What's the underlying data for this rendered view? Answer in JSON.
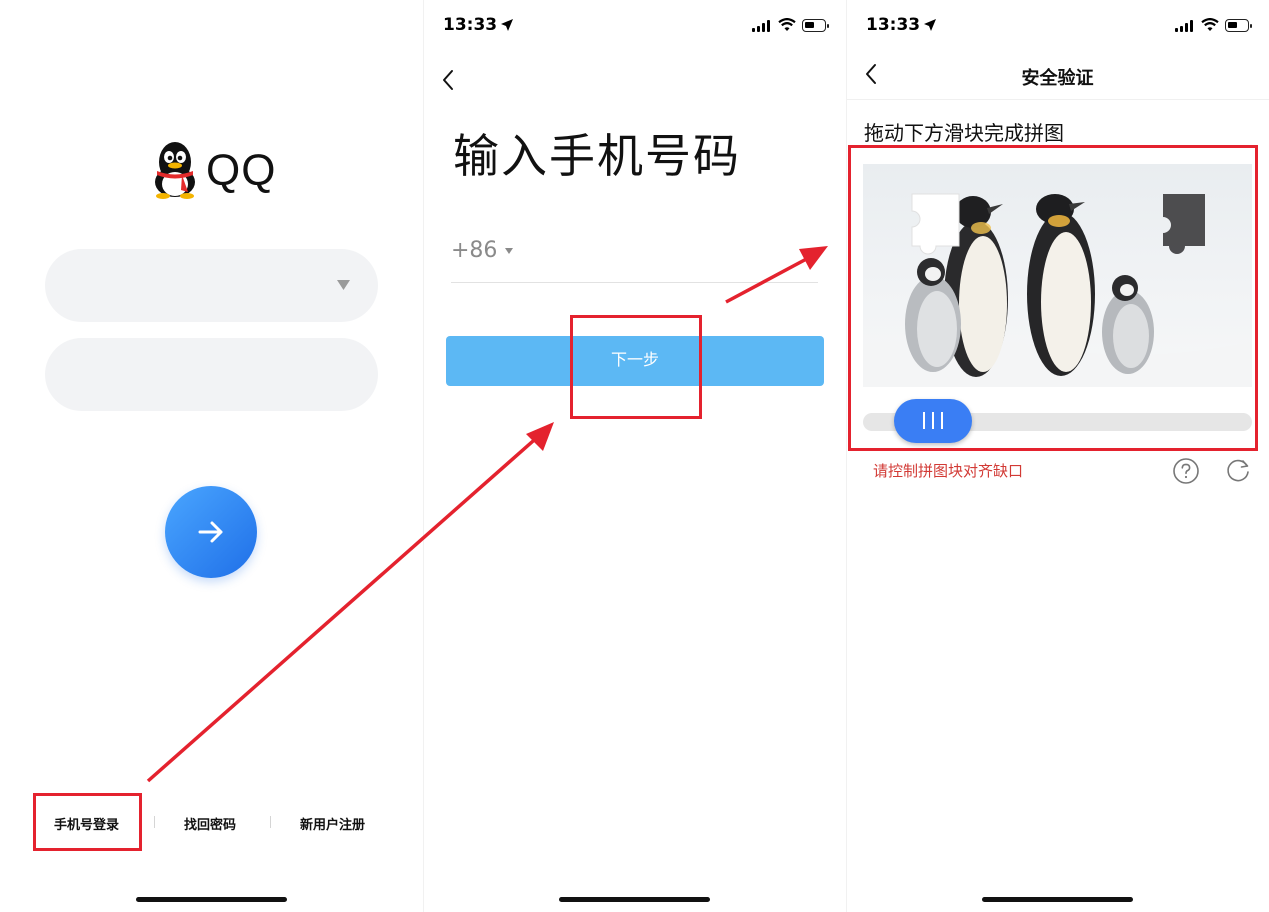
{
  "screen_login": {
    "app_name": "QQ",
    "footer": {
      "phone_login": "手机号登录",
      "forgot_password": "找回密码",
      "register": "新用户注册"
    }
  },
  "screen_phone": {
    "status_time": "13:33",
    "title": "输入手机号码",
    "country_code": "+86",
    "next_button": "下一步"
  },
  "screen_verify": {
    "status_time": "13:33",
    "nav_title": "安全验证",
    "instruction": "拖动下方滑块完成拼图",
    "error_message": "请控制拼图块对齐缺口"
  },
  "colors": {
    "accent_blue": "#3a7ef4",
    "next_button_blue": "#5cb8f4",
    "annotation_red": "#e4222e",
    "error_red": "#d23a35"
  },
  "icons": [
    "qq-penguin-icon",
    "dropdown-triangle-icon",
    "arrow-right-icon",
    "back-chevron-icon",
    "location-arrow-icon",
    "signal-icon",
    "wifi-icon",
    "battery-icon",
    "help-circle-icon",
    "refresh-icon"
  ]
}
